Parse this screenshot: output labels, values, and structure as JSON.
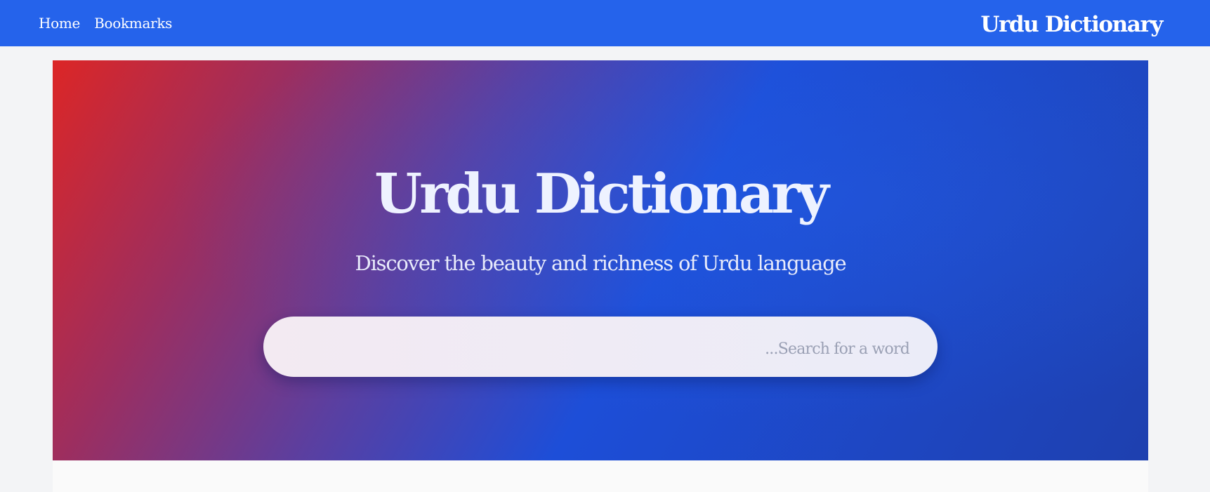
{
  "nav": {
    "home_label": "Home",
    "bookmarks_label": "Bookmarks",
    "brand": "Urdu Dictionary"
  },
  "hero": {
    "title": "Urdu Dictionary",
    "subtitle": "Discover the beauty and richness of Urdu language",
    "search": {
      "placeholder": "Search for a word...",
      "value": ""
    }
  },
  "colors": {
    "topbar": "#2563eb",
    "hero_gradient_start": "#dc2626",
    "hero_gradient_end": "#1e40af",
    "page_background": "#f3f4f6"
  }
}
